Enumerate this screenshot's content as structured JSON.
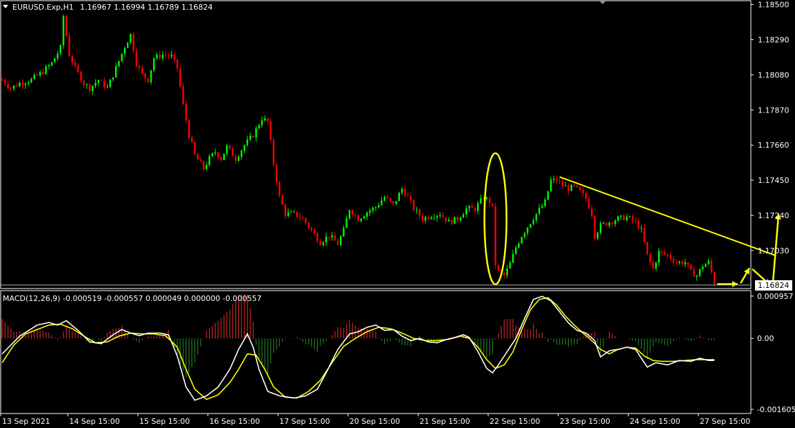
{
  "main_header": {
    "symbol": "EURUSD.Exp,H1",
    "ohlc": "1.16967 1.16994 1.16789 1.16824"
  },
  "macd_header": {
    "label": "MACD(12,26,9) -0.000519 -0.000557 0.000049 0.000000 -0.000557"
  },
  "colors": {
    "background": "#000000",
    "bull": "#00ff00",
    "bear": "#ff0000",
    "hist_pos": "#b22222",
    "hist_neg": "#1f6b1f",
    "macd_line": "#ffffff",
    "signal_line": "#ffff00",
    "annotation": "#ffff00",
    "axis": "#ffffff",
    "current_price_line": "#aab4c8"
  },
  "chart_data": [
    {
      "type": "candlestick",
      "symbol": "EURUSD.Exp",
      "timeframe": "H1",
      "y_ticks": [
        "1.18500",
        "1.18290",
        "1.18080",
        "1.17870",
        "1.17660",
        "1.17450",
        "1.17240",
        "1.17030"
      ],
      "y_tick_values": [
        1.185,
        1.1829,
        1.1808,
        1.1787,
        1.1766,
        1.1745,
        1.1724,
        1.1703
      ],
      "ylim": [
        1.16803,
        1.18523
      ],
      "current_price": "1.16824",
      "current_price_value": 1.16824,
      "x_ticks": [
        "13 Sep 2021",
        "14 Sep 15:00",
        "15 Sep 15:00",
        "16 Sep 15:00",
        "17 Sep 15:00",
        "20 Sep 15:00",
        "21 Sep 15:00",
        "22 Sep 15:00",
        "23 Sep 15:00",
        "24 Sep 15:00",
        "27 Sep 15:00"
      ],
      "x_tick_bars": [
        0,
        23,
        47,
        71,
        95,
        119,
        143,
        167,
        191,
        215,
        239
      ],
      "bar_count": 257,
      "close_path": [
        [
          0,
          1.1805
        ],
        [
          3,
          1.18
        ],
        [
          6,
          1.1803
        ],
        [
          10,
          1.1805
        ],
        [
          14,
          1.181
        ],
        [
          17,
          1.1815
        ],
        [
          20,
          1.1824
        ],
        [
          21,
          1.1843
        ],
        [
          23,
          1.182
        ],
        [
          25,
          1.1812
        ],
        [
          28,
          1.1803
        ],
        [
          30,
          1.18
        ],
        [
          33,
          1.1805
        ],
        [
          36,
          1.18
        ],
        [
          39,
          1.1812
        ],
        [
          42,
          1.1825
        ],
        [
          44,
          1.1832
        ],
        [
          46,
          1.1815
        ],
        [
          48,
          1.1808
        ],
        [
          50,
          1.1805
        ],
        [
          52,
          1.1818
        ],
        [
          55,
          1.182
        ],
        [
          58,
          1.1819
        ],
        [
          60,
          1.1812
        ],
        [
          62,
          1.179
        ],
        [
          64,
          1.1772
        ],
        [
          66,
          1.176
        ],
        [
          69,
          1.1752
        ],
        [
          71,
          1.1758
        ],
        [
          73,
          1.1762
        ],
        [
          75,
          1.1758
        ],
        [
          77,
          1.1765
        ],
        [
          80,
          1.1758
        ],
        [
          83,
          1.1766
        ],
        [
          86,
          1.1772
        ],
        [
          89,
          1.1782
        ],
        [
          91,
          1.178
        ],
        [
          93,
          1.1755
        ],
        [
          95,
          1.1735
        ],
        [
          97,
          1.1725
        ],
        [
          100,
          1.1725
        ],
        [
          103,
          1.1722
        ],
        [
          106,
          1.1715
        ],
        [
          109,
          1.1708
        ],
        [
          112,
          1.1712
        ],
        [
          115,
          1.1707
        ],
        [
          117,
          1.1715
        ],
        [
          119,
          1.1728
        ],
        [
          122,
          1.1722
        ],
        [
          125,
          1.1726
        ],
        [
          128,
          1.1729
        ],
        [
          131,
          1.1735
        ],
        [
          134,
          1.173
        ],
        [
          137,
          1.174
        ],
        [
          139,
          1.1735
        ],
        [
          141,
          1.1728
        ],
        [
          144,
          1.1722
        ],
        [
          147,
          1.1724
        ],
        [
          150,
          1.1725
        ],
        [
          153,
          1.172
        ],
        [
          156,
          1.1722
        ],
        [
          159,
          1.1728
        ],
        [
          162,
          1.1728
        ],
        [
          165,
          1.1735
        ],
        [
          167,
          1.1732
        ],
        [
          168,
          1.1728
        ],
        [
          169,
          1.1695
        ],
        [
          170,
          1.169
        ],
        [
          172,
          1.1688
        ],
        [
          174,
          1.1695
        ],
        [
          176,
          1.1705
        ],
        [
          178,
          1.1712
        ],
        [
          181,
          1.172
        ],
        [
          183,
          1.1725
        ],
        [
          186,
          1.1732
        ],
        [
          188,
          1.1745
        ],
        [
          190,
          1.1745
        ],
        [
          192,
          1.1742
        ],
        [
          194,
          1.174
        ],
        [
          196,
          1.1741
        ],
        [
          198,
          1.1738
        ],
        [
          200,
          1.1734
        ],
        [
          202,
          1.1725
        ],
        [
          203,
          1.1712
        ],
        [
          205,
          1.1718
        ],
        [
          208,
          1.172
        ],
        [
          211,
          1.1722
        ],
        [
          214,
          1.1723
        ],
        [
          217,
          1.172
        ],
        [
          219,
          1.1715
        ],
        [
          221,
          1.17
        ],
        [
          223,
          1.1692
        ],
        [
          225,
          1.1702
        ],
        [
          228,
          1.17
        ],
        [
          231,
          1.1696
        ],
        [
          234,
          1.1696
        ],
        [
          236,
          1.169
        ],
        [
          238,
          1.1688
        ],
        [
          240,
          1.1694
        ],
        [
          242,
          1.1696
        ],
        [
          243,
          1.169
        ],
        [
          244,
          1.1684
        ]
      ]
    },
    {
      "type": "macd",
      "params": [
        12,
        26,
        9
      ],
      "y_ticks": [
        "0.000957",
        "0.00",
        "-0.001605"
      ],
      "y_tick_values": [
        0.000957,
        0.0,
        -0.001605
      ],
      "ylim": [
        -0.0017,
        0.00108
      ],
      "macd": [
        [
          0,
          -0.00035
        ],
        [
          6,
          5e-05
        ],
        [
          12,
          0.0003
        ],
        [
          16,
          0.00036
        ],
        [
          19,
          0.0003
        ],
        [
          22,
          0.0004
        ],
        [
          26,
          0.00018
        ],
        [
          30,
          -8e-05
        ],
        [
          34,
          -0.00012
        ],
        [
          38,
          8e-05
        ],
        [
          41,
          0.0002
        ],
        [
          44,
          0.00012
        ],
        [
          47,
          6e-05
        ],
        [
          50,
          0.00012
        ],
        [
          54,
          0.00012
        ],
        [
          57,
          8e-05
        ],
        [
          60,
          -0.0004
        ],
        [
          63,
          -0.0011
        ],
        [
          66,
          -0.0014
        ],
        [
          70,
          -0.0013
        ],
        [
          74,
          -0.0011
        ],
        [
          78,
          -0.0007
        ],
        [
          81,
          -0.00025
        ],
        [
          84,
          0.0001
        ],
        [
          86,
          -0.0002
        ],
        [
          88,
          -0.0007
        ],
        [
          91,
          -0.0012
        ],
        [
          95,
          -0.0013
        ],
        [
          100,
          -0.00135
        ],
        [
          104,
          -0.0013
        ],
        [
          108,
          -0.00115
        ],
        [
          111,
          -0.00078
        ],
        [
          115,
          -0.00025
        ],
        [
          119,
          0.0001
        ],
        [
          122,
          0.00015
        ],
        [
          125,
          0.00025
        ],
        [
          128,
          0.0003
        ],
        [
          131,
          0.00018
        ],
        [
          134,
          0.0002
        ],
        [
          137,
          5e-05
        ],
        [
          140,
          -5e-05
        ],
        [
          143,
          0.0
        ],
        [
          146,
          -8e-05
        ],
        [
          149,
          -0.0001
        ],
        [
          152,
          -3e-05
        ],
        [
          155,
          2e-05
        ],
        [
          158,
          8e-05
        ],
        [
          160,
          2e-05
        ],
        [
          163,
          -0.0003
        ],
        [
          166,
          -0.00068
        ],
        [
          168,
          -0.00078
        ],
        [
          170,
          -0.0006
        ],
        [
          173,
          -0.0003
        ],
        [
          176,
          0.0
        ],
        [
          179,
          0.00045
        ],
        [
          182,
          0.00088
        ],
        [
          185,
          0.00095
        ],
        [
          188,
          0.00085
        ],
        [
          191,
          0.0006
        ],
        [
          194,
          0.00035
        ],
        [
          197,
          0.00018
        ],
        [
          200,
          0.00012
        ],
        [
          203,
          -5e-05
        ],
        [
          205,
          -0.00042
        ],
        [
          208,
          -0.00028
        ],
        [
          211,
          -0.00025
        ],
        [
          214,
          -0.0002
        ],
        [
          217,
          -0.00025
        ],
        [
          219,
          -0.00045
        ],
        [
          221,
          -0.00065
        ],
        [
          224,
          -0.00055
        ],
        [
          228,
          -0.0006
        ],
        [
          232,
          -0.0005
        ],
        [
          236,
          -0.00052
        ],
        [
          239,
          -0.00045
        ],
        [
          242,
          -0.0005
        ]
      ],
      "signal": [
        [
          0,
          -0.00055
        ],
        [
          4,
          -0.00015
        ],
        [
          8,
          0.0001
        ],
        [
          12,
          0.0002
        ],
        [
          16,
          0.0003
        ],
        [
          20,
          0.00032
        ],
        [
          24,
          0.00022
        ],
        [
          28,
          5e-05
        ],
        [
          32,
          -0.0001
        ],
        [
          36,
          -8e-05
        ],
        [
          40,
          5e-05
        ],
        [
          44,
          0.00012
        ],
        [
          48,
          0.0001
        ],
        [
          52,
          0.0001
        ],
        [
          56,
          6e-05
        ],
        [
          60,
          -0.0002
        ],
        [
          63,
          -0.0007
        ],
        [
          66,
          -0.00115
        ],
        [
          70,
          -0.00138
        ],
        [
          74,
          -0.00128
        ],
        [
          78,
          -0.001
        ],
        [
          81,
          -0.0007
        ],
        [
          84,
          -0.00035
        ],
        [
          87,
          -0.00038
        ],
        [
          90,
          -0.0007
        ],
        [
          93,
          -0.0011
        ],
        [
          97,
          -0.00133
        ],
        [
          101,
          -0.00135
        ],
        [
          105,
          -0.0012
        ],
        [
          109,
          -0.00095
        ],
        [
          113,
          -0.00055
        ],
        [
          117,
          -0.00018
        ],
        [
          121,
          0.0
        ],
        [
          125,
          0.00015
        ],
        [
          129,
          0.00025
        ],
        [
          133,
          0.00022
        ],
        [
          137,
          0.00012
        ],
        [
          141,
          0.0
        ],
        [
          145,
          -5e-05
        ],
        [
          149,
          -5e-05
        ],
        [
          153,
          -2e-05
        ],
        [
          157,
          5e-05
        ],
        [
          160,
          0.0
        ],
        [
          163,
          -0.0002
        ],
        [
          166,
          -0.00048
        ],
        [
          169,
          -0.00068
        ],
        [
          172,
          -0.0006
        ],
        [
          175,
          -0.0003
        ],
        [
          178,
          0.0002
        ],
        [
          181,
          0.00065
        ],
        [
          184,
          0.00088
        ],
        [
          187,
          0.00092
        ],
        [
          190,
          0.00075
        ],
        [
          193,
          0.0005
        ],
        [
          196,
          0.0003
        ],
        [
          199,
          0.00012
        ],
        [
          202,
          -5e-05
        ],
        [
          205,
          -0.00025
        ],
        [
          208,
          -0.00035
        ],
        [
          211,
          -0.00025
        ],
        [
          214,
          -0.0002
        ],
        [
          217,
          -0.00022
        ],
        [
          220,
          -0.0004
        ],
        [
          223,
          -0.0005
        ],
        [
          226,
          -0.00052
        ],
        [
          230,
          -0.00052
        ],
        [
          234,
          -0.0005
        ],
        [
          238,
          -0.00048
        ],
        [
          242,
          -0.00048
        ]
      ]
    }
  ]
}
